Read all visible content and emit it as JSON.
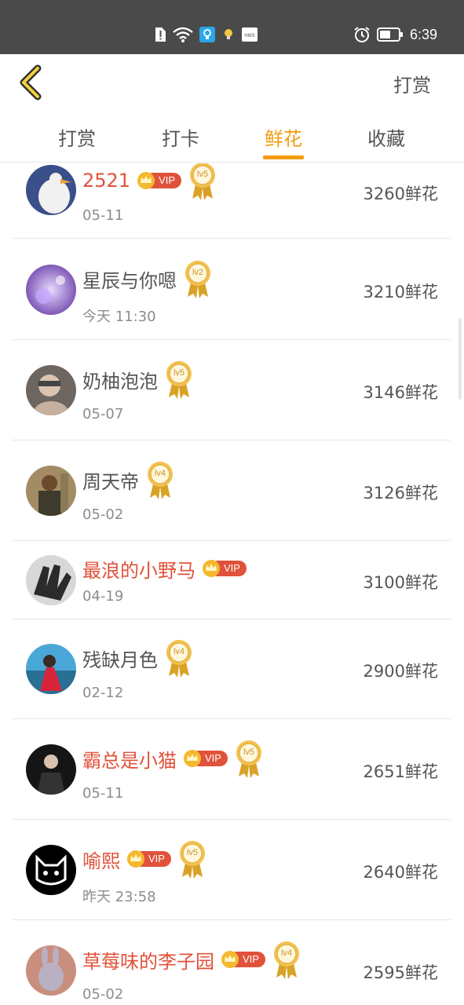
{
  "status_bar": {
    "time": "6:39",
    "icons": [
      "sim-alert-icon",
      "wifi-icon",
      "app-notification-icon",
      "lightbulb-icon",
      "hms-icon",
      "alarm-icon",
      "battery-icon"
    ],
    "hms_label": "HMS"
  },
  "header": {
    "action_label": "打赏",
    "accent": "#f39c12"
  },
  "tabs": [
    {
      "label": "打赏",
      "active": false
    },
    {
      "label": "打卡",
      "active": false
    },
    {
      "label": "鲜花",
      "active": true
    },
    {
      "label": "收藏",
      "active": false
    }
  ],
  "badges": {
    "vip_label": "VIP",
    "vip_color": "#e0523a"
  },
  "list": [
    {
      "name": "2521",
      "vip": true,
      "level": "lv5",
      "date": "05-11",
      "amount": "3260鲜花"
    },
    {
      "name": "星辰与你嗯",
      "vip": false,
      "level": "lv2",
      "date": "今天 11:30",
      "amount": "3210鲜花"
    },
    {
      "name": "奶柚泡泡",
      "vip": false,
      "level": "lv5",
      "date": "05-07",
      "amount": "3146鲜花"
    },
    {
      "name": "周天帝",
      "vip": false,
      "level": "lv4",
      "date": "05-02",
      "amount": "3126鲜花"
    },
    {
      "name": "最浪的小野马",
      "vip": true,
      "level": "",
      "date": "04-19",
      "amount": "3100鲜花"
    },
    {
      "name": "残缺月色",
      "vip": false,
      "level": "lv4",
      "date": "02-12",
      "amount": "2900鲜花"
    },
    {
      "name": "霸总是小猫",
      "vip": true,
      "level": "lv5",
      "date": "05-11",
      "amount": "2651鲜花"
    },
    {
      "name": "喻熙",
      "vip": true,
      "level": "lv5",
      "date": "昨天 23:58",
      "amount": "2640鲜花"
    },
    {
      "name": "草莓味的李子园",
      "vip": true,
      "level": "lv4",
      "date": "05-02",
      "amount": "2595鲜花"
    }
  ]
}
